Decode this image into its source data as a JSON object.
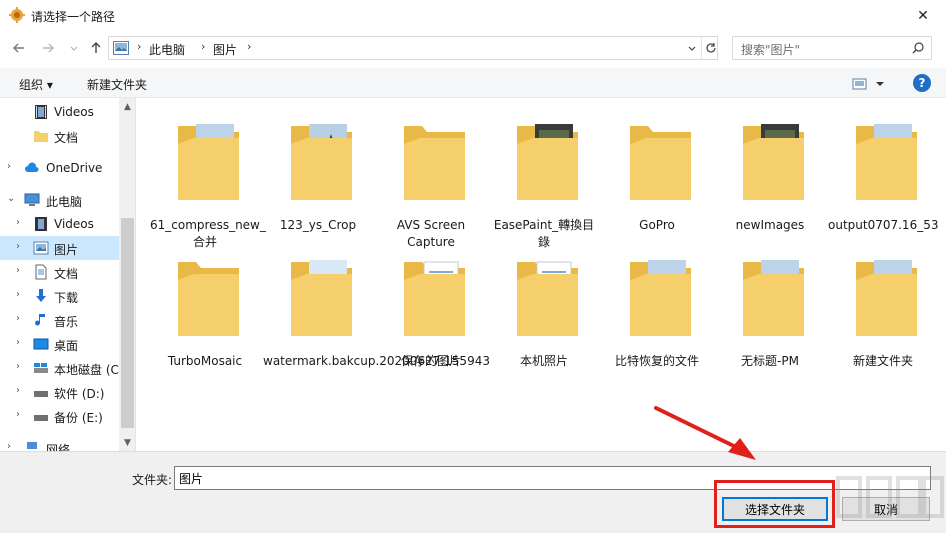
{
  "window": {
    "title": "请选择一个路径",
    "close_glyph": "✕"
  },
  "nav": {
    "breadcrumbs": [
      "此电脑",
      "图片"
    ],
    "search_placeholder": "搜索\"图片\""
  },
  "toolbar": {
    "organize": "组织 ▾",
    "new_folder": "新建文件夹",
    "help": "?"
  },
  "sidebar": {
    "items": [
      {
        "label": "Videos",
        "icon": "video-icon",
        "arrow": ""
      },
      {
        "label": "文档",
        "icon": "folder-icon",
        "arrow": ""
      },
      {
        "label": "OneDrive",
        "icon": "cloud-icon",
        "arrow": "›"
      },
      {
        "label": "此电脑",
        "icon": "computer-icon",
        "arrow": "⌄"
      },
      {
        "label": "Videos",
        "icon": "video-icon",
        "arrow": "›"
      },
      {
        "label": "图片",
        "icon": "pictures-icon",
        "arrow": "›"
      },
      {
        "label": "文档",
        "icon": "document-icon",
        "arrow": "›"
      },
      {
        "label": "下载",
        "icon": "download-icon",
        "arrow": "›"
      },
      {
        "label": "音乐",
        "icon": "music-icon",
        "arrow": "›"
      },
      {
        "label": "桌面",
        "icon": "desktop-icon",
        "arrow": "›"
      },
      {
        "label": "本地磁盘 (C",
        "icon": "drive-icon",
        "arrow": "›"
      },
      {
        "label": "软件 (D:)",
        "icon": "drive-icon",
        "arrow": "›"
      },
      {
        "label": "备份 (E:)",
        "icon": "drive-icon",
        "arrow": "›"
      },
      {
        "label": "网络",
        "icon": "network-icon",
        "arrow": "›"
      }
    ]
  },
  "files": [
    {
      "name": "61_compress_new_合并",
      "thumb": "landscape"
    },
    {
      "name": "123_ys_Crop",
      "thumb": "forest"
    },
    {
      "name": "AVS Screen Capture",
      "thumb": "empty"
    },
    {
      "name": "EasePaint_轉換目錄",
      "thumb": "dark"
    },
    {
      "name": "GoPro",
      "thumb": "empty"
    },
    {
      "name": "newImages",
      "thumb": "dark"
    },
    {
      "name": "output0707.16_53",
      "thumb": "landscape"
    },
    {
      "name": "TurboMosaic",
      "thumb": "empty"
    },
    {
      "name": "watermark.bakcup.20200627.155943",
      "thumb": "sea"
    },
    {
      "name": "保存的图片",
      "thumb": "docs"
    },
    {
      "name": "本机照片",
      "thumb": "docs"
    },
    {
      "name": "比特恢复的文件",
      "thumb": "landscape"
    },
    {
      "name": "无标题-PM",
      "thumb": "landscape"
    },
    {
      "name": "新建文件夹",
      "thumb": "landscape"
    }
  ],
  "footer": {
    "folder_label": "文件夹:",
    "folder_value": "图片",
    "select_button": "选择文件夹",
    "cancel_button": "取消"
  },
  "colors": {
    "selected": "#cce8ff",
    "accent": "#0078d7",
    "annotation": "#e0201a",
    "folder": "#f4cf6b"
  }
}
